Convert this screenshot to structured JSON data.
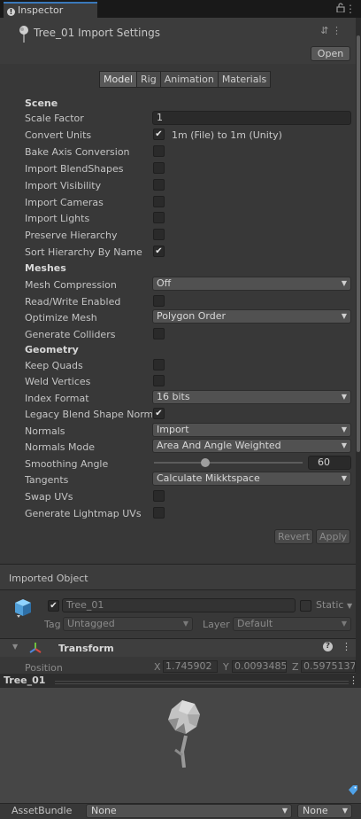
{
  "window": {
    "tab_label": "Inspector",
    "lock_icon": "lock-icon",
    "menu_icon": "kebab-icon"
  },
  "header": {
    "title": "Tree_01 Import Settings",
    "settings_glyph": "⇵",
    "menu_glyph": "⋮",
    "open_label": "Open"
  },
  "tabs": [
    "Model",
    "Rig",
    "Animation",
    "Materials"
  ],
  "active_tab": "Model",
  "scene": {
    "heading": "Scene",
    "scale_factor": {
      "label": "Scale Factor",
      "value": "1"
    },
    "convert_units": {
      "label": "Convert Units",
      "checked": true,
      "text": "1m (File) to 1m (Unity)"
    },
    "bake_axis": {
      "label": "Bake Axis Conversion",
      "checked": false
    },
    "import_blendshapes": {
      "label": "Import BlendShapes",
      "checked": false
    },
    "import_visibility": {
      "label": "Import Visibility",
      "checked": false
    },
    "import_cameras": {
      "label": "Import Cameras",
      "checked": false
    },
    "import_lights": {
      "label": "Import Lights",
      "checked": false
    },
    "preserve_hierarchy": {
      "label": "Preserve Hierarchy",
      "checked": false
    },
    "sort_hierarchy": {
      "label": "Sort Hierarchy By Name",
      "checked": true
    }
  },
  "meshes": {
    "heading": "Meshes",
    "compression": {
      "label": "Mesh Compression",
      "value": "Off"
    },
    "read_write": {
      "label": "Read/Write Enabled",
      "checked": false
    },
    "optimize": {
      "label": "Optimize Mesh",
      "value": "Polygon Order"
    },
    "colliders": {
      "label": "Generate Colliders",
      "checked": false
    }
  },
  "geometry": {
    "heading": "Geometry",
    "keep_quads": {
      "label": "Keep Quads",
      "checked": false
    },
    "weld_vertices": {
      "label": "Weld Vertices",
      "checked": false
    },
    "index_format": {
      "label": "Index Format",
      "value": "16 bits"
    },
    "legacy_blend": {
      "label": "Legacy Blend Shape Normals",
      "checked": true
    },
    "normals": {
      "label": "Normals",
      "value": "Import"
    },
    "normals_mode": {
      "label": "Normals Mode",
      "value": "Area And Angle Weighted"
    },
    "smoothing": {
      "label": "Smoothing Angle",
      "value": "60",
      "min": 0,
      "max": 180
    },
    "tangents": {
      "label": "Tangents",
      "value": "Calculate Mikktspace"
    },
    "swap_uvs": {
      "label": "Swap UVs",
      "checked": false
    },
    "lightmap_uvs": {
      "label": "Generate Lightmap UVs",
      "checked": false
    }
  },
  "actions": {
    "revert": "Revert",
    "apply": "Apply"
  },
  "imported": {
    "heading": "Imported Object",
    "name": "Tree_01",
    "static_label": "Static",
    "tag_label": "Tag",
    "tag_value": "Untagged",
    "layer_label": "Layer",
    "layer_value": "Default",
    "transform_label": "Transform",
    "position_label": "Position",
    "pos_x_label": "X",
    "pos_x": "1.745902",
    "pos_y_label": "Y",
    "pos_y": "0.0093485",
    "pos_z_label": "Z",
    "pos_z": "0.5975137"
  },
  "preview": {
    "title": "Tree_01"
  },
  "bottom": {
    "label": "AssetBundle",
    "bundle": "None",
    "variant": "None"
  },
  "colors": {
    "accent": "#3a79bb",
    "bg": "#383838",
    "field": "#2a2a2a"
  }
}
